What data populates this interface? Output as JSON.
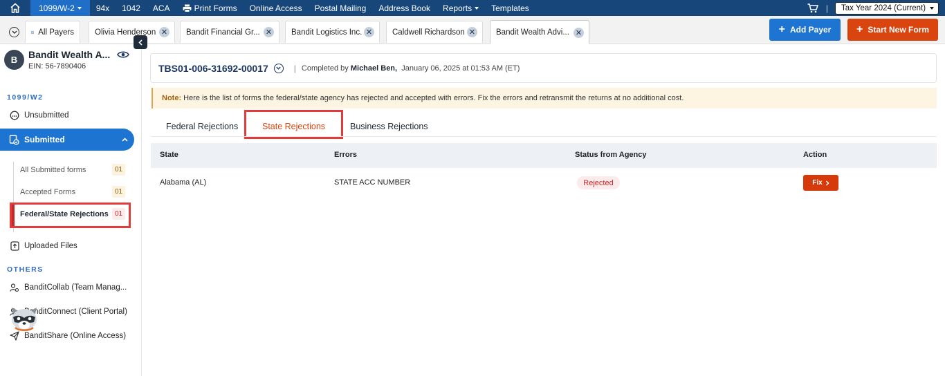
{
  "topnav": {
    "home_icon": "home-icon",
    "items": [
      {
        "label": "1099/W-2",
        "active": true,
        "has_dropdown": true
      },
      {
        "label": "94x"
      },
      {
        "label": "1042"
      },
      {
        "label": "ACA"
      },
      {
        "label": "Print Forms",
        "icon": "printer-icon"
      },
      {
        "label": "Online Access"
      },
      {
        "label": "Postal Mailing"
      },
      {
        "label": "Address Book"
      },
      {
        "label": "Reports",
        "has_dropdown": true
      },
      {
        "label": "Templates"
      }
    ],
    "cart_icon": "cart-icon",
    "separator": "|",
    "tax_year": "Tax Year 2024 (Current)"
  },
  "tabbar": {
    "all_payers_label": "All Payers",
    "tabs": [
      {
        "label": "Olivia Henderson"
      },
      {
        "label": "Bandit Financial Gr..."
      },
      {
        "label": "Bandit Logistics Inc."
      },
      {
        "label": "Caldwell Richardson"
      },
      {
        "label": "Bandit Wealth Advi...",
        "active": true
      }
    ],
    "close_glyph": "✕",
    "add_payer_label": "Add Payer",
    "start_new_form_label": "Start New Form",
    "colors": {
      "primary": "#1e74d1",
      "accent": "#d9440f"
    }
  },
  "sidebar": {
    "avatar_letter": "B",
    "payer_name": "Bandit Wealth A...",
    "ein": "EIN: 56-7890406",
    "section1": "1099/W2",
    "unsubmitted": "Unsubmitted",
    "submitted": "Submitted",
    "sub_items": [
      {
        "label": "All Submitted forms",
        "count": "01"
      },
      {
        "label": "Accepted Forms",
        "count": "01"
      },
      {
        "label": "Federal/State Rejections",
        "count": "01",
        "active": true
      }
    ],
    "uploaded_files": "Uploaded Files",
    "section2": "OTHERS",
    "others": [
      {
        "label": "BanditCollab (Team Manag...",
        "icon": "team-icon"
      },
      {
        "label": "BanditConnect (Client Portal)",
        "icon": "connect-icon"
      },
      {
        "label": "BanditShare (Online Access)",
        "icon": "send-icon"
      }
    ]
  },
  "main": {
    "form_id": "TBS01-006-31692-00017",
    "completed_prefix": "Completed by",
    "completed_by": "Michael Ben,",
    "completed_date": "January 06, 2025 at 01:53 AM (ET)",
    "note_label": "Note:",
    "note_text": "Here is the list of forms the federal/state agency has rejected and accepted with errors. Fix the errors and retransmit the returns at no additional cost.",
    "tabs": [
      {
        "label": "Federal Rejections"
      },
      {
        "label": "State Rejections",
        "active": true
      },
      {
        "label": "Business Rejections"
      }
    ],
    "table": {
      "headers": [
        "State",
        "Errors",
        "Status from Agency",
        "Action"
      ],
      "rows": [
        {
          "state": "Alabama (AL)",
          "errors": "STATE ACC NUMBER",
          "status": "Rejected",
          "action": "Fix"
        }
      ]
    }
  }
}
